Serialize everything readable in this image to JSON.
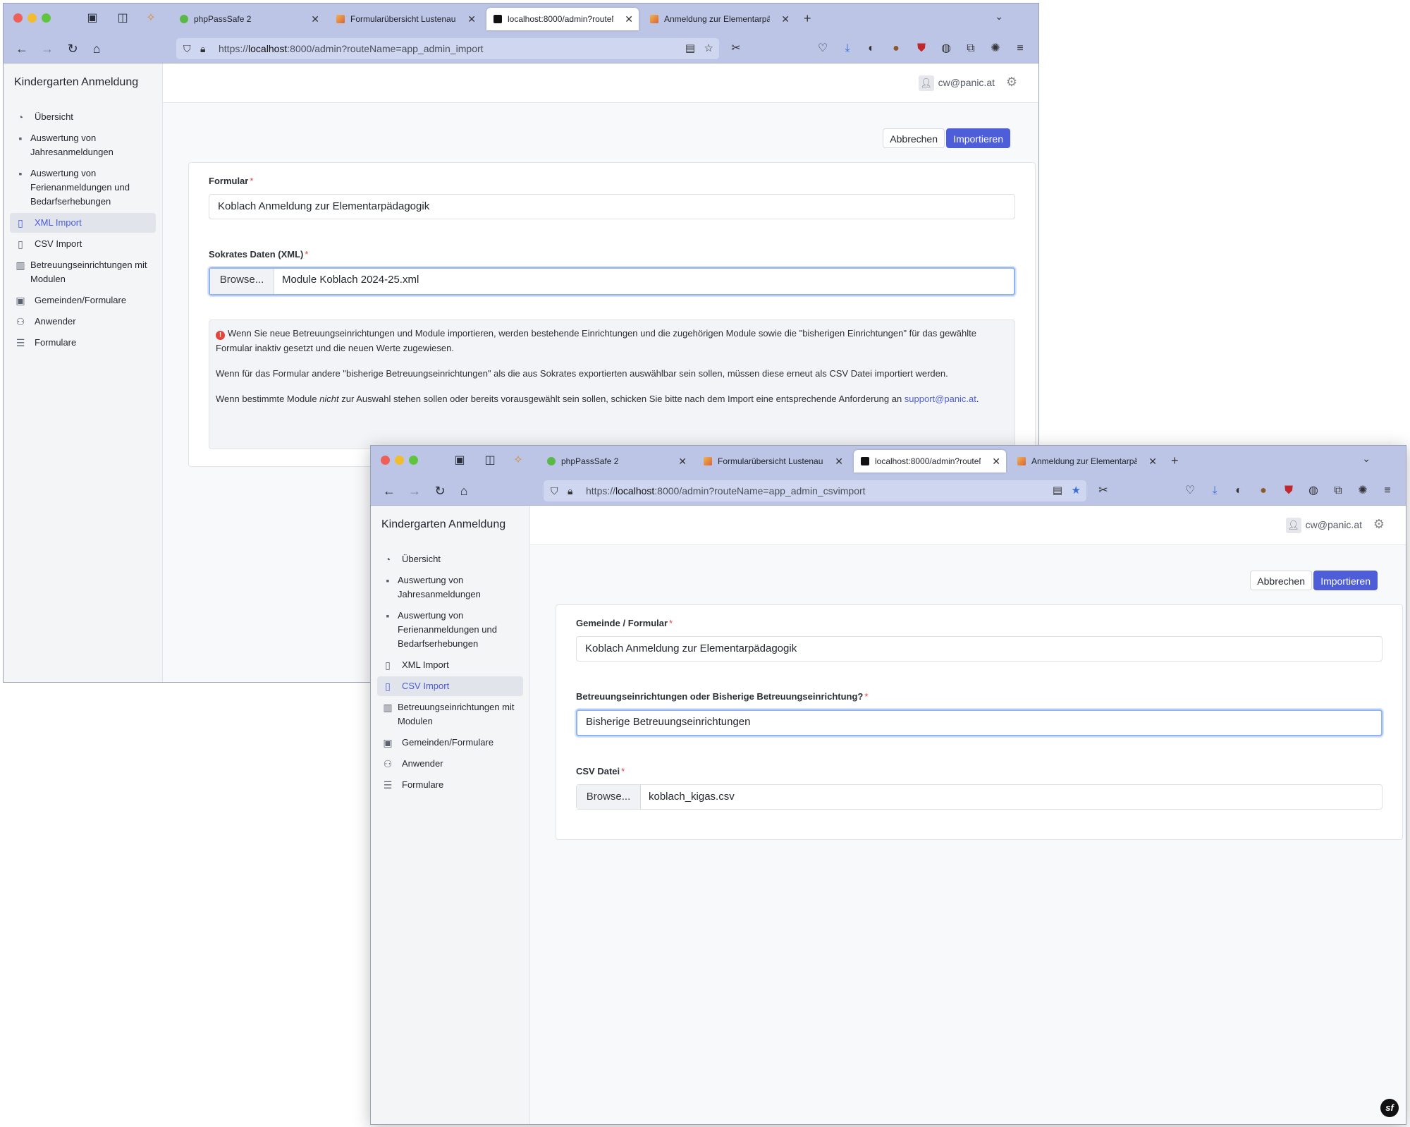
{
  "browser": {
    "tabs": [
      {
        "label": "phpPassSafe 2"
      },
      {
        "label": "Formularübersicht Lustenau"
      },
      {
        "label": "localhost:8000/admin?routeNa"
      },
      {
        "label": "Anmeldung zur Elementarpädag"
      }
    ],
    "win1_url": {
      "prefix": "https://",
      "host": "localhost",
      "rest": ":8000/admin?routeName=app_admin_import"
    },
    "win2_url": {
      "prefix": "https://",
      "host": "localhost",
      "rest": ":8000/admin?routeName=app_admin_csvimport"
    }
  },
  "app": {
    "brand": "Kindergarten Anmeldung",
    "user": "cw@panic.at",
    "menu": [
      {
        "label": "Übersicht",
        "icon": "gauge-icon"
      },
      {
        "label": "Auswertung von Jahresanmeldungen",
        "icon": "book-icon"
      },
      {
        "label": "Auswertung von Ferienanmeldungen und Bedarfserhebungen",
        "icon": "book-icon"
      },
      {
        "label": "XML Import",
        "icon": "file-code-icon"
      },
      {
        "label": "CSV Import",
        "icon": "file-csv-icon"
      },
      {
        "label": "Betreuungseinrichtungen mit Modulen",
        "icon": "building-icon"
      },
      {
        "label": "Gemeinden/Formulare",
        "icon": "address-book-icon"
      },
      {
        "label": "Anwender",
        "icon": "users-icon"
      },
      {
        "label": "Formulare",
        "icon": "list-icon"
      }
    ],
    "cancel_label": "Abbrechen",
    "import_label": "Importieren"
  },
  "xml_import": {
    "active_menu": "XML Import",
    "formular_label": "Formular",
    "formular_value": "Koblach Anmeldung zur Elementarpädagogik",
    "sokrates_label": "Sokrates Daten (XML)",
    "browse_label": "Browse...",
    "file_name": "Module Koblach 2024-25.xml",
    "alert_p1": "Wenn Sie neue Betreuungseinrichtungen und Module importieren, werden bestehende Einrichtungen und die zugehörigen Module sowie die \"bisherigen Einrichtungen\" für das gewählte Formular inaktiv gesetzt und die neuen Werte zugewiesen.",
    "alert_p2": "Wenn für das Formular andere \"bisherige Betreuungseinrichtungen\" als die aus Sokrates exportierten auswählbar sein sollen, müssen diese erneut als CSV Datei importiert werden.",
    "alert_p3_a": "Wenn bestimmte Module ",
    "alert_p3_em": "nicht",
    "alert_p3_b": " zur Auswahl stehen sollen oder bereits vorausgewählt sein sollen, schicken Sie bitte nach dem Import eine entsprechende Anforderung an ",
    "alert_link": "support@panic.at",
    "alert_p3_end": "."
  },
  "csv_import": {
    "active_menu": "CSV Import",
    "gemeinde_label": "Gemeinde / Formular",
    "gemeinde_value": "Koblach Anmeldung zur Elementarpädagogik",
    "type_label": "Betreuungseinrichtungen oder Bisherige Betreuungseinrichtung?",
    "type_value": "Bisherige Betreuungseinrichtungen",
    "csv_label": "CSV Datei",
    "browse_label": "Browse...",
    "file_name": "koblach_kigas.csv"
  },
  "colors": {
    "accent": "#4e5ed8",
    "required": "#e2453b",
    "chrome": "#bcc5e6"
  },
  "symfony_badge": "sf"
}
